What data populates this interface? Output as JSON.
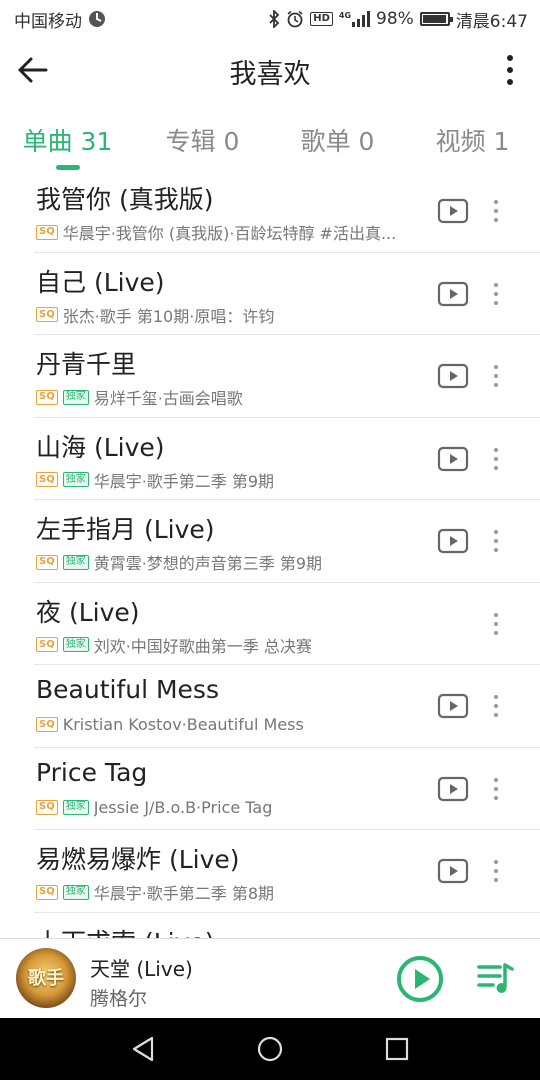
{
  "status_bar": {
    "carrier": "中国移动",
    "network": "4G",
    "battery": "98%",
    "battery_level": 0.98,
    "time": "清晨6:47"
  },
  "header": {
    "title": "我喜欢",
    "back_icon": "arrow-left-icon",
    "more_icon": "vertical-dots-icon"
  },
  "tabs": [
    {
      "label": "单曲 31",
      "active": true
    },
    {
      "label": "专辑 0",
      "active": false
    },
    {
      "label": "歌单 0",
      "active": false
    },
    {
      "label": "视频 1",
      "active": false
    }
  ],
  "songs": [
    {
      "title": "我管你 (真我版)",
      "sq": "SQ",
      "exclusive": "",
      "subtitle": "华晨宇·我管你 (真我版)·百龄坛特醇 #活出真...",
      "has_mv": true
    },
    {
      "title": "自己 (Live)",
      "sq": "SQ",
      "exclusive": "",
      "subtitle": "张杰·歌手 第10期·原唱：许钧",
      "has_mv": true
    },
    {
      "title": "丹青千里",
      "sq": "SQ",
      "exclusive": "独家",
      "subtitle": "易烊千玺·古画会唱歌",
      "has_mv": true
    },
    {
      "title": "山海 (Live)",
      "sq": "SQ",
      "exclusive": "独家",
      "subtitle": "华晨宇·歌手第二季 第9期",
      "has_mv": true
    },
    {
      "title": "左手指月 (Live)",
      "sq": "SQ",
      "exclusive": "独家",
      "subtitle": "黄霄雲·梦想的声音第三季 第9期",
      "has_mv": true
    },
    {
      "title": "夜 (Live)",
      "sq": "SQ",
      "exclusive": "独家",
      "subtitle": "刘欢·中国好歌曲第一季 总决赛",
      "has_mv": false
    },
    {
      "title": "Beautiful Mess",
      "sq": "SQ",
      "exclusive": "",
      "subtitle": "Kristian Kostov·Beautiful Mess",
      "has_mv": true
    },
    {
      "title": "Price Tag",
      "sq": "SQ",
      "exclusive": "独家",
      "subtitle": "Jessie J/B.o.B·Price Tag",
      "has_mv": true
    },
    {
      "title": "易燃易爆炸 (Live)",
      "sq": "SQ",
      "exclusive": "独家",
      "subtitle": "华晨宇·歌手第二季 第8期",
      "has_mv": true
    },
    {
      "title": "上下求索 (Live)",
      "sq": "",
      "exclusive": "",
      "subtitle": "",
      "has_mv": false
    }
  ],
  "now_playing": {
    "title": "天堂 (Live)",
    "artist": "腾格尔",
    "cover_text": "歌手"
  },
  "colors": {
    "accent": "#2bb673",
    "sq_badge": "#e8a33a"
  }
}
